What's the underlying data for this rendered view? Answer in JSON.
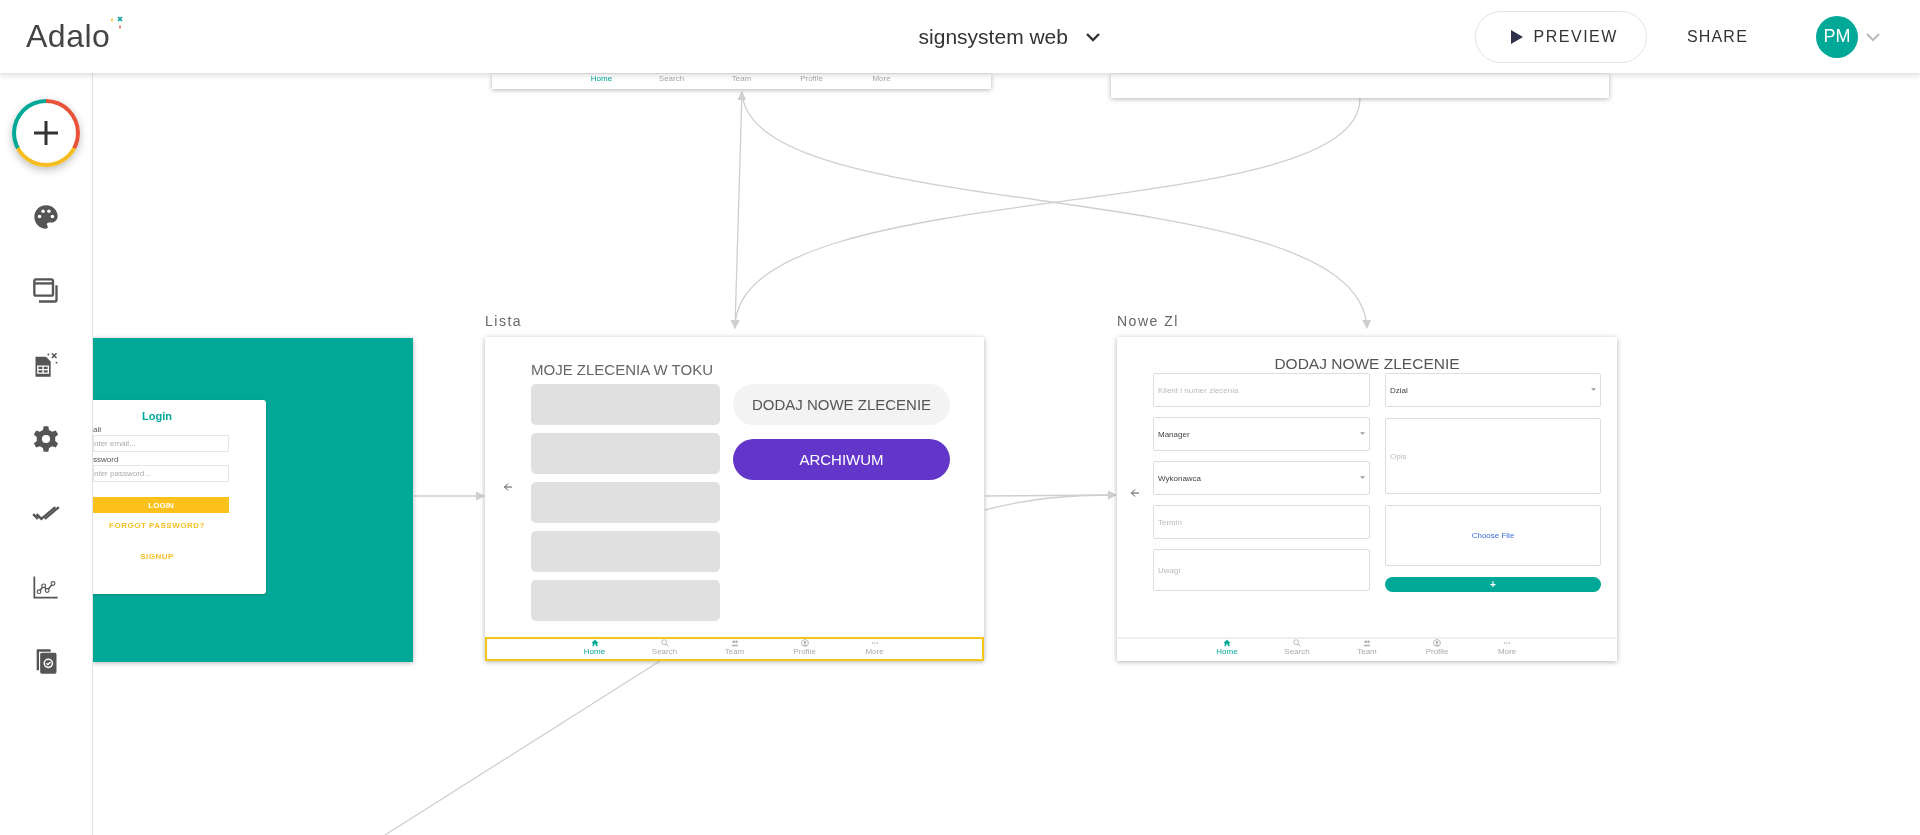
{
  "header": {
    "logo": "Adalo",
    "app_name": "signsystem web",
    "preview": "PREVIEW",
    "share": "SHARE",
    "avatar": "PM"
  },
  "screens": [
    {
      "kind": "partial",
      "nav": {
        "items": [
          {
            "label": "Home",
            "selected": true
          },
          {
            "label": "Search",
            "selected": false
          },
          {
            "label": "Team",
            "selected": false
          },
          {
            "label": "Profile",
            "selected": false
          },
          {
            "label": "More",
            "selected": false
          }
        ]
      }
    },
    {
      "kind": "blank"
    },
    {
      "kind": "login",
      "title": "Login",
      "fields": [
        {
          "label": "ail",
          "placeholder": "nter email..."
        },
        {
          "label": "ssword",
          "placeholder": "nter password..."
        }
      ],
      "button": "LOGIN",
      "links": [
        "FORGOT PASSWORD?",
        "SIGNUP"
      ]
    },
    {
      "kind": "list",
      "name": "Lista",
      "title": "MOJE ZLECENIA W TOKU",
      "list_items": [
        {
          "kind": "placeholder"
        },
        {
          "kind": "placeholder"
        },
        {
          "kind": "placeholder"
        },
        {
          "kind": "placeholder"
        },
        {
          "kind": "placeholder"
        }
      ],
      "buttons": [
        {
          "kind": "secondary",
          "label": "DODAJ NOWE ZLECENIE"
        },
        {
          "kind": "primary",
          "label": "ARCHIWUM"
        }
      ],
      "nav": {
        "selected": true,
        "items": [
          {
            "label": "Home",
            "selected": true
          },
          {
            "label": "Search",
            "selected": false
          },
          {
            "label": "Team",
            "selected": false
          },
          {
            "label": "Profile",
            "selected": false
          },
          {
            "label": "More",
            "selected": false
          }
        ]
      }
    },
    {
      "kind": "form",
      "name": "Nowe Zl",
      "title": "DODAJ NOWE ZLECENIE",
      "left_fields": [
        {
          "kind": "input",
          "placeholder": "Klient i numer zlecenia"
        },
        {
          "kind": "select",
          "value": "Manager"
        },
        {
          "kind": "select",
          "value": "Wykonawca"
        },
        {
          "kind": "input",
          "placeholder": "Termin"
        },
        {
          "kind": "textarea",
          "placeholder": "Uwagi"
        }
      ],
      "right_fields": [
        {
          "kind": "select",
          "value": "Dzial"
        },
        {
          "kind": "textarea",
          "placeholder": "Opis"
        },
        {
          "kind": "file",
          "link": "Choose File"
        }
      ],
      "add_button": "+",
      "nav": {
        "selected": false,
        "items": [
          {
            "label": "Home",
            "selected": true
          },
          {
            "label": "Search",
            "selected": false
          },
          {
            "label": "Team",
            "selected": false
          },
          {
            "label": "Profile",
            "selected": false
          },
          {
            "label": "More",
            "selected": false
          }
        ]
      }
    }
  ]
}
